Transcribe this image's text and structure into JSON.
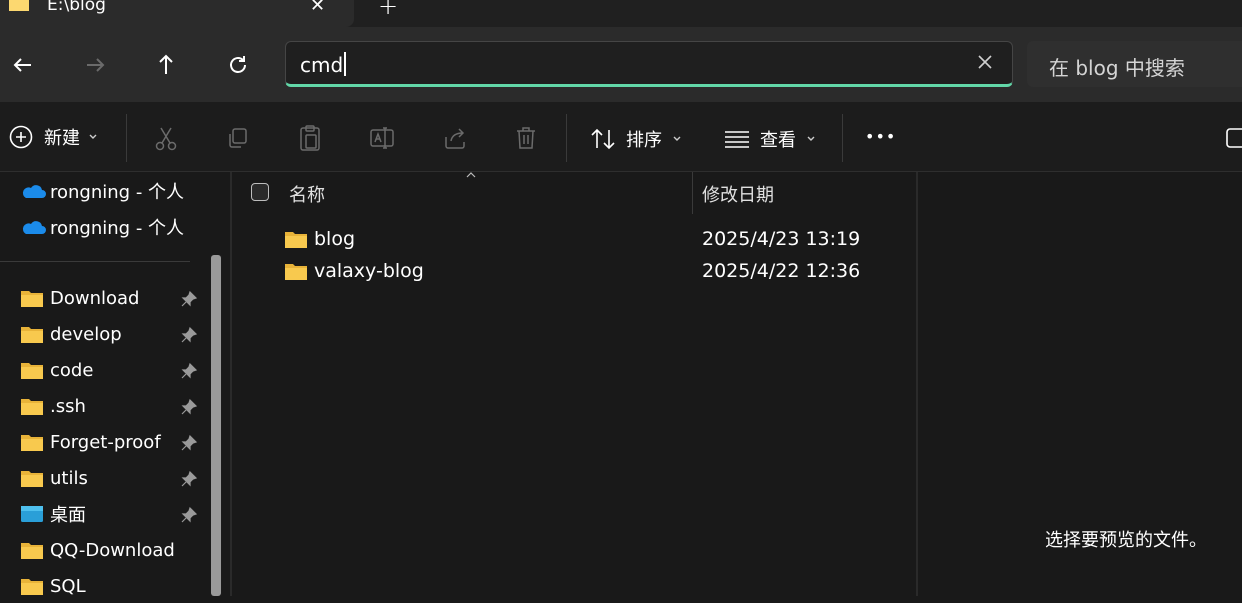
{
  "tab": {
    "title": "E:\\blog",
    "close": "✕",
    "new": "+"
  },
  "nav": {
    "address_value": "cmd",
    "search_placeholder": "在 blog 中搜索"
  },
  "toolbar": {
    "new_label": "新建",
    "sort_label": "排序",
    "view_label": "查看",
    "more_label": "•••"
  },
  "sidebar": {
    "cloud": [
      "rongning - 个人",
      "rongning - 个人"
    ],
    "items": [
      {
        "label": "Download",
        "pinned": true
      },
      {
        "label": "develop",
        "pinned": true
      },
      {
        "label": "code",
        "pinned": true
      },
      {
        "label": ".ssh",
        "pinned": true
      },
      {
        "label": "Forget-proof",
        "pinned": true
      },
      {
        "label": "utils",
        "pinned": true
      },
      {
        "label": "桌面",
        "pinned": true
      },
      {
        "label": "QQ-Download",
        "pinned": false
      },
      {
        "label": "SQL",
        "pinned": false
      }
    ]
  },
  "list": {
    "columns": {
      "name": "名称",
      "modified": "修改日期"
    },
    "rows": [
      {
        "name": "blog",
        "modified": "2025/4/23 13:19"
      },
      {
        "name": "valaxy-blog",
        "modified": "2025/4/22 12:36"
      }
    ]
  },
  "preview": {
    "empty_text": "选择要预览的文件。"
  },
  "colors": {
    "accent": "#62d7a8",
    "folder": "#f8c94e",
    "onedrive": "#1b8bea"
  }
}
